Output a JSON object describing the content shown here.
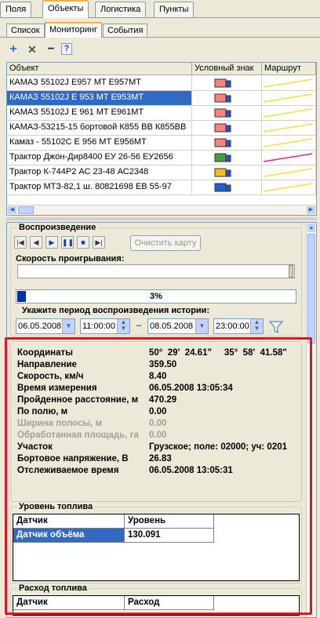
{
  "tabs": [
    "Поля",
    "Объекты",
    "Логистика",
    "Пункты"
  ],
  "subtabs": [
    "Список",
    "Мониторинг",
    "События"
  ],
  "toolbar": {
    "add": "+",
    "delete": "✕",
    "minus": "−",
    "help": "?"
  },
  "grid": {
    "columns": [
      "Объект",
      "Условный знак",
      "Маршрут"
    ],
    "rows": [
      {
        "name": "КАМАЗ 55102J  E957 MT E957MT",
        "color": "#ff8080"
      },
      {
        "name": "КАМАЗ 55102J   E 953 MT E953MT",
        "color": "#ff8080"
      },
      {
        "name": "КАМАЗ 55102J   E 961 MT E961MT",
        "color": "#ff8080"
      },
      {
        "name": "КАМАЗ-53215-15 бортовой К855 ВВ К855ВВ",
        "color": "#ff8080"
      },
      {
        "name": "Камаз - 55102С Е 956 МТ Е956МТ",
        "color": "#ff8080"
      },
      {
        "name": "Трактор Джон-Дир8400 ЕУ 26-56 ЕУ2656",
        "color": "#4a9a4a"
      },
      {
        "name": "Трактор К-744Р2 АС 23-48 АС2348",
        "color": "#f0c020"
      },
      {
        "name": "Трактор МТЗ-82,1 ш. 80821698 ЕВ 55-97",
        "color": "#2060d0"
      }
    ]
  },
  "playback": {
    "legend": "Воспроизведение",
    "clear_label": "Очистить карту",
    "speed_label": "Скорость проигрывания:",
    "progress_text": "3%",
    "progress": 0.03,
    "period_label": "Укажите период воспроизведения истории:",
    "date_from": "06.05.2008",
    "time_from": "11:00:00",
    "dash": "–",
    "date_to": "08.05.2008",
    "time_to": "23:00:00"
  },
  "info": {
    "coords_label": "Координаты",
    "coords_value": "50°  29'  24.61\"     35°  58'  41.58\"",
    "direction_label": "Направление",
    "direction_value": "359.50",
    "speed_label": "Скорость, км/ч",
    "speed_value": "8.40",
    "time_label": "Время измерения",
    "time_value": "06.05.2008 13:05:34",
    "distance_label": "Пройденное расстояние, м",
    "distance_value": "470.29",
    "field_label": "По полю, м",
    "field_value": "0.00",
    "width_label": "Ширина полосы, м",
    "width_value": "0.00",
    "area_label": "Обработанная площадь, га",
    "area_value": "0.00",
    "plot_label": "Участок",
    "plot_value": "Грузское; поле: 02000; уч: 0201",
    "voltage_label": "Бортовое напряжение, В",
    "voltage_value": "26.83",
    "tracked_label": "Отслеживаемое время",
    "tracked_value": "06.05.2008 13:05:31"
  },
  "fuel_level": {
    "legend": "Уровень топлива",
    "col_sensor": "Датчик",
    "col_level": "Уровень",
    "sensor": "Датчик объёма",
    "value": "130.091"
  },
  "fuel_consumption": {
    "legend": "Расход топлива",
    "col_sensor": "Датчик",
    "col_consumption": "Расход"
  }
}
